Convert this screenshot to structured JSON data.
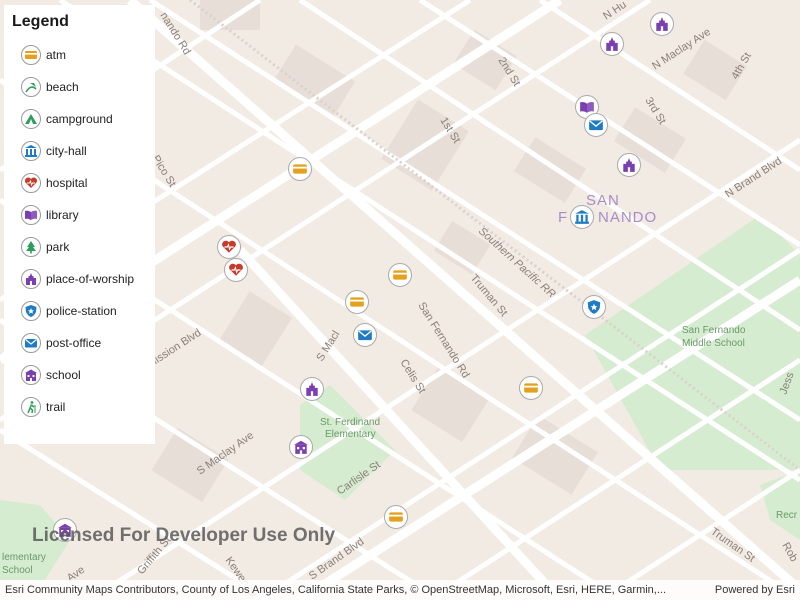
{
  "legend": {
    "title": "Legend",
    "items": [
      {
        "label": "atm",
        "icon": "atm-icon",
        "color": "#e5a11c"
      },
      {
        "label": "beach",
        "icon": "beach-icon",
        "color": "#2e9e5b"
      },
      {
        "label": "campground",
        "icon": "campground-icon",
        "color": "#2e9e5b"
      },
      {
        "label": "city-hall",
        "icon": "city-hall-icon",
        "color": "#1e7bc4"
      },
      {
        "label": "hospital",
        "icon": "hospital-icon",
        "color": "#c83a2a"
      },
      {
        "label": "library",
        "icon": "library-icon",
        "color": "#7a3fb0"
      },
      {
        "label": "park",
        "icon": "park-icon",
        "color": "#2e9e5b"
      },
      {
        "label": "place-of-worship",
        "icon": "place-of-worship-icon",
        "color": "#7a3fb0"
      },
      {
        "label": "police-station",
        "icon": "police-station-icon",
        "color": "#1e7bc4"
      },
      {
        "label": "post-office",
        "icon": "post-office-icon",
        "color": "#1e7bc4"
      },
      {
        "label": "school",
        "icon": "school-icon",
        "color": "#7a3fb0"
      },
      {
        "label": "trail",
        "icon": "trail-icon",
        "color": "#2e9e5b"
      }
    ]
  },
  "map": {
    "streets": [
      "San Fernando Rd",
      "Truman St",
      "Celis St",
      "S Maclay Ave",
      "Carlisle St",
      "S Brand Blvd",
      "N Maclay Ave",
      "N Brand Blvd",
      "1st St",
      "2nd St",
      "3rd St",
      "4th St",
      "Pico St",
      "Griffith St",
      "Kewen St",
      "Mission Blvd",
      "S Macl",
      "N Hu",
      "nando Rd",
      "Jess",
      "Rob",
      "Truman St",
      "Ave"
    ],
    "district": "SAN FERNANDO",
    "district_parts": [
      "SAN",
      "F",
      "NANDO"
    ],
    "places": [
      "San Fernando Middle School",
      "St. Ferdinand Elementary",
      "Southern Pacific RR",
      "Elementary School"
    ],
    "place_lines": {
      "middle_school": [
        "San Fernando",
        "Middle School"
      ],
      "st_ferdinand": [
        "St. Ferdinand",
        "Elementary"
      ],
      "elementary_school": [
        "lementary",
        "School"
      ],
      "railroad": "Southern Pacific RR",
      "green_label": "Recr"
    }
  },
  "watermark": "Licensed For Developer Use Only",
  "attribution": {
    "left": "Esri Community Maps Contributors, County of Los Angeles, California State Parks, © OpenStreetMap, Microsoft, Esri, HERE, Garmin,...",
    "right": "Powered by Esri"
  },
  "markers": [
    {
      "type": "place-of-worship",
      "icon": "place-of-worship-icon"
    },
    {
      "type": "place-of-worship",
      "icon": "place-of-worship-icon"
    },
    {
      "type": "library",
      "icon": "library-icon"
    },
    {
      "type": "post-office",
      "icon": "post-office-icon"
    },
    {
      "type": "place-of-worship",
      "icon": "place-of-worship-icon"
    },
    {
      "type": "atm",
      "icon": "atm-icon"
    },
    {
      "type": "city-hall",
      "icon": "city-hall-icon"
    },
    {
      "type": "hospital",
      "icon": "hospital-icon"
    },
    {
      "type": "hospital",
      "icon": "hospital-icon"
    },
    {
      "type": "atm",
      "icon": "atm-icon"
    },
    {
      "type": "atm",
      "icon": "atm-icon"
    },
    {
      "type": "post-office",
      "icon": "post-office-icon"
    },
    {
      "type": "police-station",
      "icon": "police-station-icon"
    },
    {
      "type": "place-of-worship",
      "icon": "place-of-worship-icon"
    },
    {
      "type": "atm",
      "icon": "atm-icon"
    },
    {
      "type": "school",
      "icon": "school-icon"
    },
    {
      "type": "atm",
      "icon": "atm-icon"
    },
    {
      "type": "school",
      "icon": "school-icon"
    }
  ]
}
